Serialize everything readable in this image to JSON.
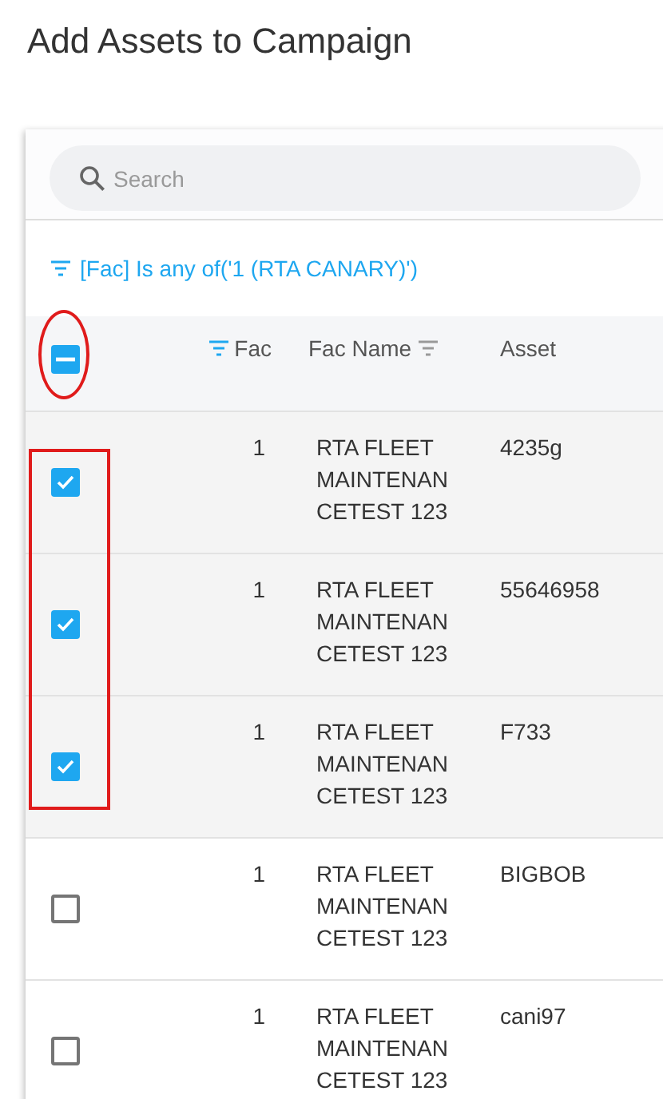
{
  "title": "Add Assets to Campaign",
  "search": {
    "placeholder": "Search"
  },
  "filter": {
    "text": "[Fac] Is any of('1 (RTA CANARY)')"
  },
  "header": {
    "select_all_checked": true,
    "select_all_indeterminate": true,
    "columns": [
      {
        "label": "Fac",
        "filter_active": true
      },
      {
        "label": "Fac Name",
        "filter_active": false
      },
      {
        "label": "Asset"
      }
    ]
  },
  "rows": [
    {
      "checked": true,
      "fac": "1",
      "fac_name": "RTA FLEET MAINTENAN CETEST 123",
      "asset": "4235g"
    },
    {
      "checked": true,
      "fac": "1",
      "fac_name": "RTA FLEET MAINTENAN CETEST 123",
      "asset": "55646958"
    },
    {
      "checked": true,
      "fac": "1",
      "fac_name": "RTA FLEET MAINTENAN CETEST 123",
      "asset": "F733"
    },
    {
      "checked": false,
      "fac": "1",
      "fac_name": "RTA FLEET MAINTENAN CETEST 123",
      "asset": "BIGBOB"
    },
    {
      "checked": false,
      "fac": "1",
      "fac_name": "RTA FLEET MAINTENAN CETEST 123",
      "asset": "cani97"
    }
  ],
  "annotations": [
    {
      "kind": "ellipse"
    },
    {
      "kind": "rectangle"
    }
  ]
}
